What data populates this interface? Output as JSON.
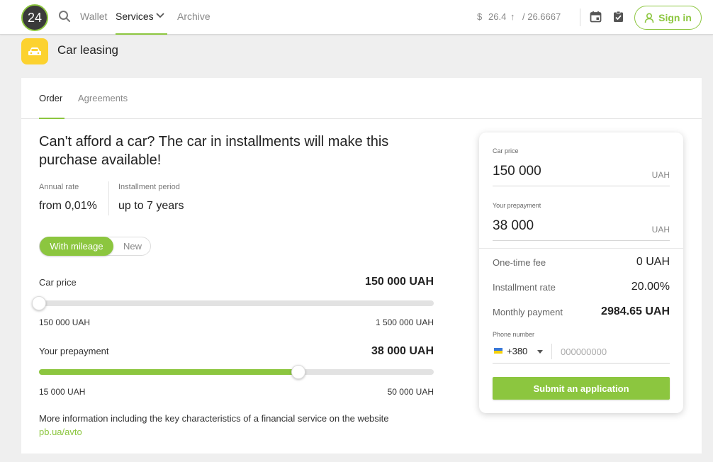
{
  "header": {
    "logo": "24",
    "nav": [
      {
        "label": "Wallet"
      },
      {
        "label": "Services"
      },
      {
        "label": "Archive"
      }
    ],
    "currency_symbol": "$",
    "rate_buy": "26.4",
    "rate_arrow": "↑",
    "rate_sell": "/ 26.6667",
    "signin_label": "Sign in",
    "accent_color": "#8cc63f"
  },
  "page": {
    "title": "Car leasing",
    "icon": "car-icon"
  },
  "tabs": [
    {
      "label": "Order"
    },
    {
      "label": "Agreements"
    }
  ],
  "main": {
    "headline": "Can't afford a car? The car in installments will make this purchase available!",
    "stats": [
      {
        "label": "Annual rate",
        "value": "from 0,01%"
      },
      {
        "label": "Installment period",
        "value": "up to 7 years"
      }
    ],
    "toggle": {
      "selected": "With mileage",
      "other": "New"
    },
    "car_price": {
      "label": "Car price",
      "value": "150 000 UAH",
      "min": "150 000 UAH",
      "max": "1 500 000 UAH",
      "level": 0.0
    },
    "prepayment": {
      "label": "Your prepayment",
      "value": "38 000 UAH",
      "min": "15 000 UAH",
      "max": "50 000 UAH",
      "level": 0.657
    },
    "info_text": "More information including the key characteristics of a financial service on the website ",
    "info_link": "pb.ua/avto"
  },
  "calculator": {
    "car_price_label": "Car price",
    "car_price_value": "150 000",
    "car_price_unit": "UAH",
    "prepayment_label": "Your prepayment",
    "prepayment_value": "38 000",
    "prepayment_unit": "UAH",
    "rows": [
      {
        "label": "One-time fee",
        "value": "0 UAH"
      },
      {
        "label": "Installment rate",
        "value": "20.00%"
      },
      {
        "label": "Monthly payment",
        "value": "2984.65 UAH"
      }
    ],
    "phone_label": "Phone number",
    "phone_code": "+380",
    "phone_placeholder": "000000000",
    "submit_label": "Submit an application"
  }
}
